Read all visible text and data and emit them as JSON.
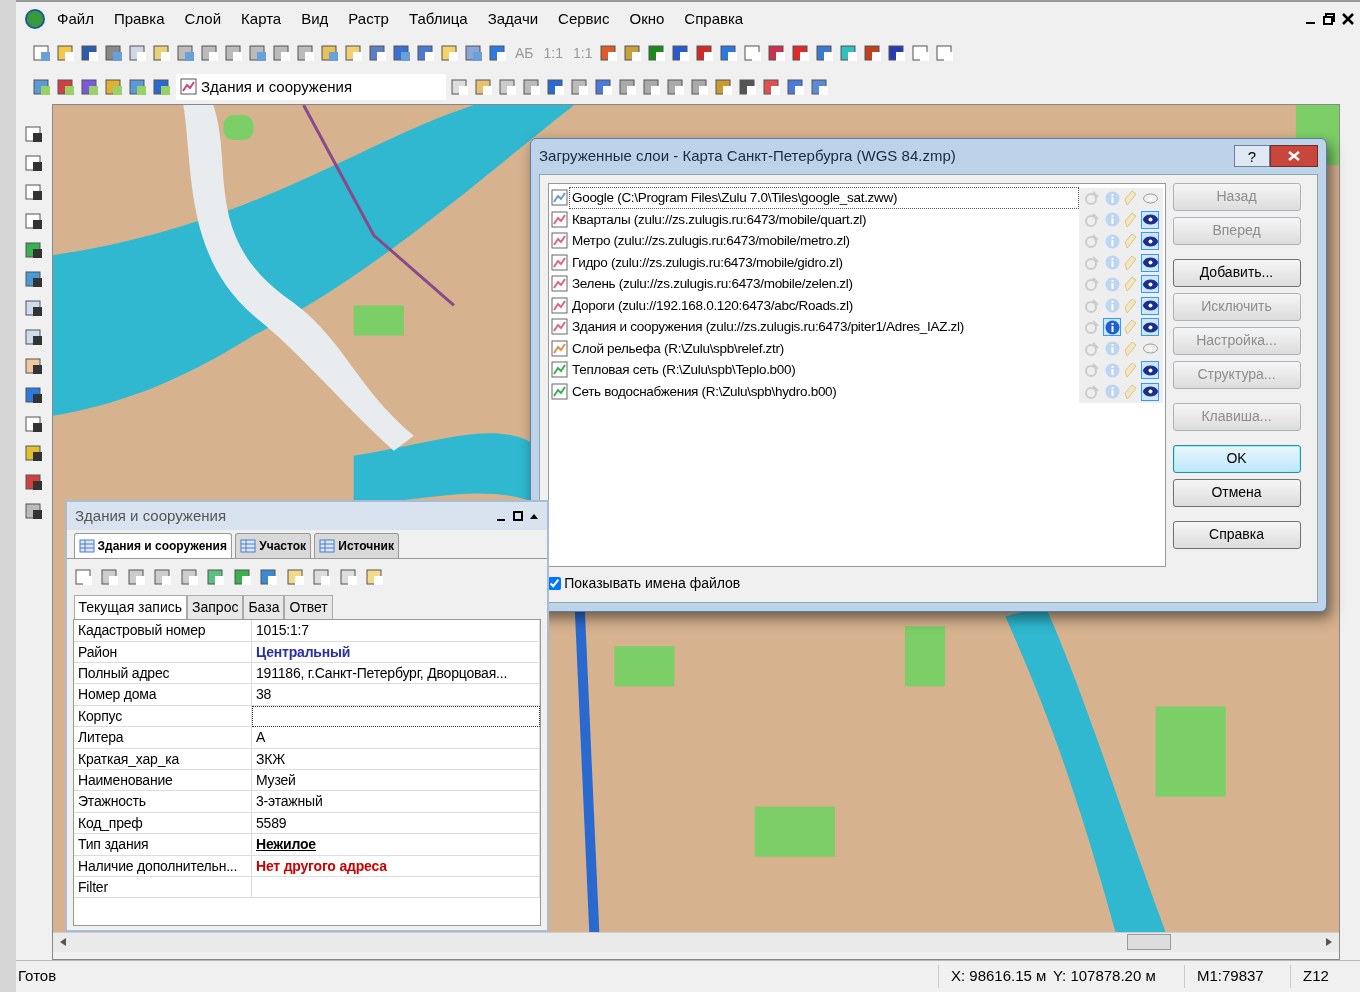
{
  "menu": [
    {
      "label": "Файл"
    },
    {
      "label": "Правка"
    },
    {
      "label": "Слой"
    },
    {
      "label": "Карта"
    },
    {
      "label": "Вид"
    },
    {
      "label": "Растр"
    },
    {
      "label": "Таблица"
    },
    {
      "label": "Задачи"
    },
    {
      "label": "Сервис"
    },
    {
      "label": "Окно"
    },
    {
      "label": "Справка"
    }
  ],
  "toolbar_text_buttons": [
    {
      "label": "АБ",
      "disabled": true
    },
    {
      "label": "1:1",
      "disabled": true
    },
    {
      "label": "1:1",
      "disabled": true
    }
  ],
  "layer_combo": {
    "value": "Здания и сооружения"
  },
  "dialog": {
    "title": "Загруженные слои - Карта Санкт-Петербурга (WGS 84.zmp)",
    "help": "?",
    "layers": [
      {
        "name": "Google (C:\\Program Files\\Zulu 7.0\\Tiles\\google_sat.zww)",
        "kind": "raster",
        "visible": false,
        "info": false,
        "selected": true
      },
      {
        "name": "Кварталы (zulu://zs.zulugis.ru:6473/mobile/quart.zl)",
        "kind": "vector",
        "visible": true,
        "info": false,
        "selected": false
      },
      {
        "name": "Метро (zulu://zs.zulugis.ru:6473/mobile/metro.zl)",
        "kind": "vector",
        "visible": true,
        "info": false,
        "selected": false
      },
      {
        "name": "Гидро (zulu://zs.zulugis.ru:6473/mobile/gidro.zl)",
        "kind": "vector",
        "visible": true,
        "info": false,
        "selected": false
      },
      {
        "name": "Зелень (zulu://zs.zulugis.ru:6473/mobile/zelen.zl)",
        "kind": "vector",
        "visible": true,
        "info": false,
        "selected": false
      },
      {
        "name": "Дороги (zulu://192.168.0.120:6473/abc/Roads.zl)",
        "kind": "vector",
        "visible": true,
        "info": false,
        "selected": false
      },
      {
        "name": "Здания и сооружения (zulu://zs.zulugis.ru:6473/piter1/Adres_IAZ.zl)",
        "kind": "vector",
        "visible": true,
        "info": true,
        "selected": false
      },
      {
        "name": "Слой рельефа (R:\\Zulu\\spb\\relef.ztr)",
        "kind": "relief",
        "visible": false,
        "info": false,
        "selected": false
      },
      {
        "name": "Тепловая сеть (R:\\Zulu\\spb\\Teplo.b00)",
        "kind": "network",
        "visible": true,
        "info": false,
        "selected": false
      },
      {
        "name": "Сеть водоснабжения (R:\\Zulu\\spb\\hydro.b00)",
        "kind": "network",
        "visible": true,
        "info": false,
        "selected": false
      }
    ],
    "buttons": [
      {
        "label": "Назад",
        "disabled": true,
        "default": false
      },
      {
        "label": "Вперед",
        "disabled": true,
        "default": false
      },
      {
        "label": "Добавить...",
        "disabled": false,
        "default": false
      },
      {
        "label": "Исключить",
        "disabled": true,
        "default": false
      },
      {
        "label": "Настройка...",
        "disabled": true,
        "default": false
      },
      {
        "label": "Структура...",
        "disabled": true,
        "default": false
      },
      {
        "label": "Клавиша...",
        "disabled": true,
        "default": false
      },
      {
        "label": "OK",
        "disabled": false,
        "default": true
      },
      {
        "label": "Отмена",
        "disabled": false,
        "default": false
      },
      {
        "label": "Справка",
        "disabled": false,
        "default": false
      }
    ],
    "show_filenames": {
      "label": "Показывать имена файлов",
      "checked": true
    }
  },
  "panel": {
    "title": "Здания и сооружения",
    "tabs": [
      {
        "label": "Здания и сооружения",
        "selected": true
      },
      {
        "label": "Участок",
        "selected": false
      },
      {
        "label": "Источник",
        "selected": false
      }
    ],
    "subtabs": [
      {
        "label": "Текущая запись",
        "selected": true
      },
      {
        "label": "Запрос",
        "selected": false
      },
      {
        "label": "База",
        "selected": false
      },
      {
        "label": "Ответ",
        "selected": false
      }
    ],
    "rows": [
      {
        "label": "Кадастровый номер",
        "value": "1015:1:7",
        "kind": "plain",
        "focused": false
      },
      {
        "label": "Район",
        "value": "Центральный",
        "kind": "link",
        "focused": false
      },
      {
        "label": "Полный адрес",
        "value": "191186, г.Санкт-Петербург, Дворцовая...",
        "kind": "plain",
        "focused": false
      },
      {
        "label": "Номер дома",
        "value": "38",
        "kind": "plain",
        "focused": false
      },
      {
        "label": "Корпус",
        "kind": "plain",
        "focused": true
      },
      {
        "label": "Литера",
        "value": "А",
        "kind": "plain",
        "focused": false
      },
      {
        "label": "Краткая_хар_ка",
        "value": "ЗКЖ",
        "kind": "plain",
        "focused": false
      },
      {
        "label": "Наименование",
        "value": "Музей",
        "kind": "plain",
        "focused": false
      },
      {
        "label": "Этажность",
        "value": "3-этажный",
        "kind": "plain",
        "focused": false
      },
      {
        "label": "Код_преф",
        "value": "5589",
        "kind": "plain",
        "focused": false
      },
      {
        "label": "Тип здания",
        "value": "Нежилое",
        "kind": "underline",
        "focused": false
      },
      {
        "label": "Наличие дополнительн...",
        "value": "Нет другого адреса",
        "kind": "alert",
        "focused": false
      },
      {
        "label": "Filter",
        "kind": "plain",
        "focused": false
      }
    ]
  },
  "status_bar": {
    "text": "Готов",
    "x": "X: 98616.15 м",
    "y": "Y: 107878.20 м",
    "scale": "M1:79837",
    "zoom": "Z12"
  }
}
